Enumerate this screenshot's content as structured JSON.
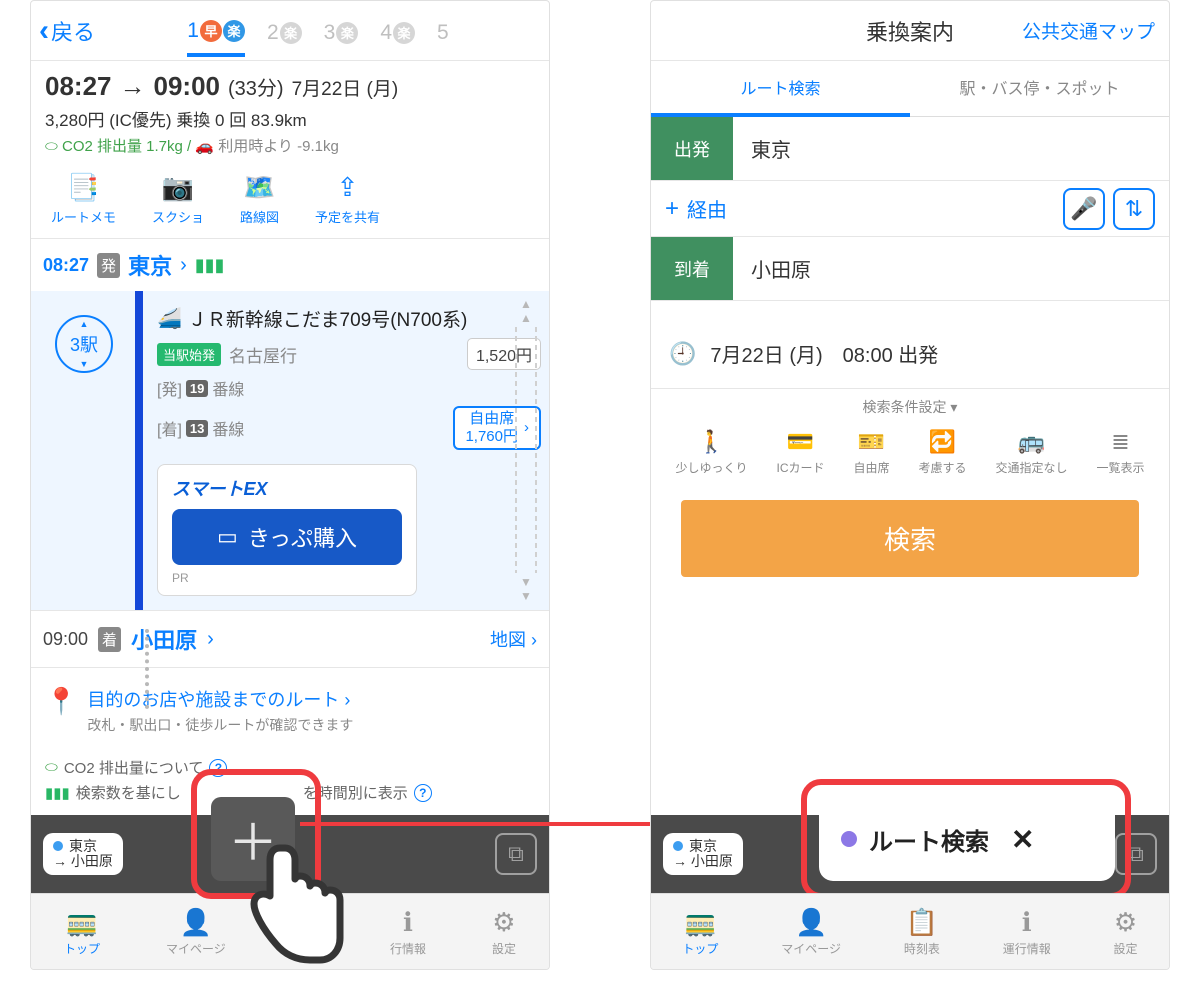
{
  "left": {
    "back": "戻る",
    "routeTabs": [
      {
        "num": "1",
        "b1": "早",
        "b2": "楽",
        "active": true
      },
      {
        "num": "2",
        "b1": "楽"
      },
      {
        "num": "3",
        "b1": "楽"
      },
      {
        "num": "4",
        "b1": "楽"
      },
      {
        "num": "5"
      }
    ],
    "dep": "08:27",
    "arr": "09:00",
    "dur": "(33分)",
    "date": "7月22日 (月)",
    "fareLine": "3,280円 (IC優先)  乗換 0 回  83.9km",
    "co2_a": "CO2 排出量 1.7kg /",
    "co2_b": "利用時より",
    "co2_c": "-9.1kg",
    "actions": [
      "ルートメモ",
      "スクショ",
      "路線図",
      "予定を共有"
    ],
    "actionIcons": [
      "📑",
      "📷",
      "🗺️",
      "⇪"
    ],
    "seg": {
      "time": "08:27",
      "badge": "発",
      "station": "東京",
      "stops": "3駅",
      "train": "ＪＲ新幹線こだま709号(N700系)",
      "startBadge": "当駅始発",
      "dest": "名古屋行",
      "platDepLbl": "[発]",
      "platDepNum": "19",
      "platDepSuf": "番線",
      "platArrLbl": "[着]",
      "platArrNum": "13",
      "platArrSuf": "番線",
      "fare": "1,520円",
      "seatLbl": "自由席",
      "seatFare": "1,760円",
      "smartex": "スマートEX",
      "buy": "きっぷ購入",
      "pr": "PR"
    },
    "arrRow": {
      "time": "09:00",
      "badge": "着",
      "station": "小田原",
      "map": "地図"
    },
    "destRoute": {
      "t1": "目的のお店や施設までのルート",
      "t2": "改札・駅出口・徒歩ルートが確認できます"
    },
    "notes": {
      "n1": "CO2 排出量について",
      "n2": "検索数を基にし",
      "n2b": "を時間別に表示"
    },
    "chip": {
      "from": "東京",
      "to": "→ 小田原"
    }
  },
  "right": {
    "title": "乗換案内",
    "link": "公共交通マップ",
    "tabs": [
      "ルート検索",
      "駅・バス停・スポット"
    ],
    "depLbl": "出発",
    "depVal": "東京",
    "via": "経由",
    "arrLbl": "到着",
    "arrVal": "小田原",
    "dt": "7月22日 (月)　08:00 出発",
    "condLbl": "検索条件設定 ▾",
    "conds": [
      {
        "i": "🚶",
        "t": "少しゆっくり"
      },
      {
        "i": "💳",
        "t": "ICカード"
      },
      {
        "i": "🎫",
        "t": "自由席"
      },
      {
        "i": "🔁",
        "t": "考慮する"
      },
      {
        "i": "🚌",
        "t": "交通指定なし"
      },
      {
        "i": "≣",
        "t": "一覧表示"
      }
    ],
    "search": "検索",
    "chip": {
      "from": "東京",
      "to": "→ 小田原"
    },
    "newChip": "ルート検索"
  },
  "bottomNav": [
    {
      "i": "🚃",
      "t": "トップ",
      "a": true
    },
    {
      "i": "👤",
      "t": "マイページ"
    },
    {
      "i": "📋",
      "t": "時刻表"
    },
    {
      "i": "ℹ︎",
      "t": "運行情報"
    },
    {
      "i": "⚙︎",
      "t": "設定"
    }
  ],
  "bottomNavLeft": [
    {
      "i": "🚃",
      "t": "トップ",
      "a": true
    },
    {
      "i": "👤",
      "t": "マイページ"
    },
    {
      "i": "📋",
      "t": ""
    },
    {
      "i": "ℹ︎",
      "t": "行情報"
    },
    {
      "i": "⚙︎",
      "t": "設定"
    }
  ]
}
